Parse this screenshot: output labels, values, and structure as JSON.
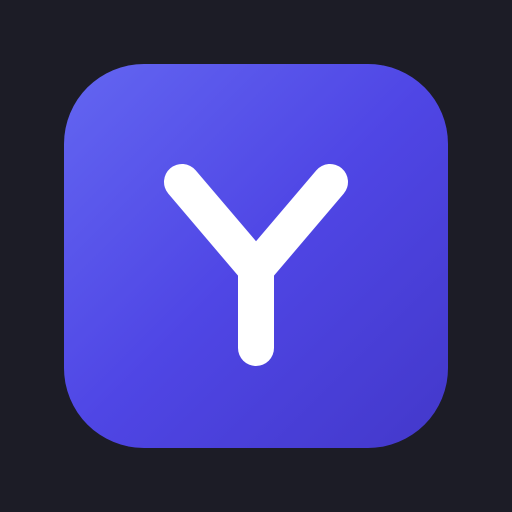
{
  "app_icon": {
    "glyph": "Y",
    "glyph_name": "letter-y-icon",
    "colors": {
      "background": "#1c1c26",
      "gradient_start": "#6366f1",
      "gradient_mid": "#4f46e5",
      "gradient_end": "#4338ca",
      "glyph": "#ffffff"
    }
  }
}
